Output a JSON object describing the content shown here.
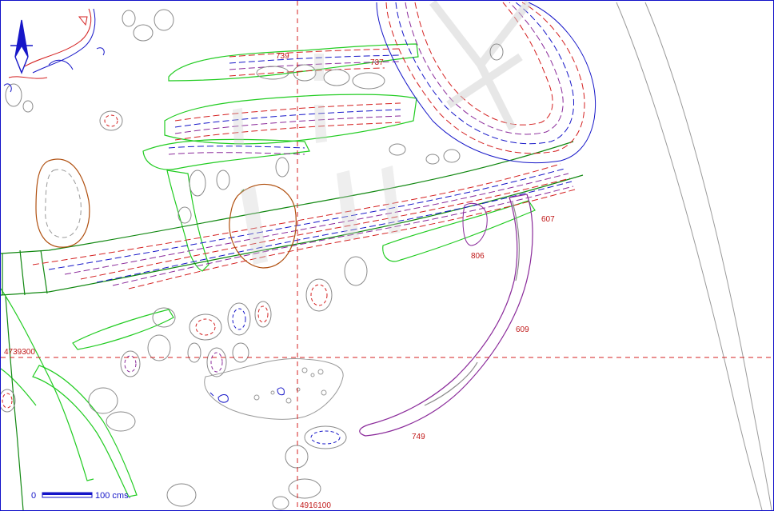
{
  "colors": {
    "grid": "#d42020",
    "stone": "#8a8a8a",
    "green": "#22cc22",
    "darkgreen": "#118811",
    "purple": "#8a2a9a",
    "blue": "#1616c8",
    "red": "#d42020",
    "brown": "#b05010"
  },
  "grid": {
    "easting_label": "4916100",
    "northing_label": "4739300"
  },
  "features": {
    "f739": "739",
    "f737": "737",
    "f607": "607",
    "f806": "806",
    "f609": "609",
    "f749": "749"
  },
  "scale": {
    "zero": "0",
    "max": "100 cms."
  },
  "north_arrow": {
    "icon": "north-arrow-icon"
  }
}
